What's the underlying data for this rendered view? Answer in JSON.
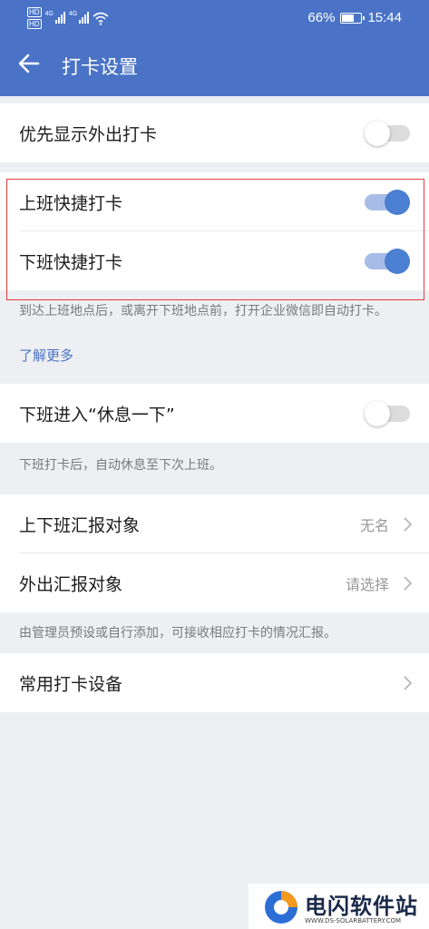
{
  "status_bar": {
    "battery_percent": "66%",
    "battery_level": 0.66,
    "time": "15:44",
    "signal_label_1": "4G",
    "signal_label_2": "4G",
    "hd_label": "HD"
  },
  "header": {
    "title": "打卡设置",
    "back_icon": "arrow-left-icon",
    "background_color": "#4a73c7"
  },
  "settings": {
    "outside_priority": {
      "label": "优先显示外出打卡",
      "enabled": false
    },
    "clock_in_quick": {
      "label": "上班快捷打卡",
      "enabled": true
    },
    "clock_out_quick": {
      "label": "下班快捷打卡",
      "enabled": true
    },
    "quick_note": "到达上班地点后，或离开下班地点前，打开企业微信即自动打卡。",
    "learn_more": "了解更多",
    "rest_after_work": {
      "label": "下班进入“休息一下”",
      "enabled": false
    },
    "rest_note": "下班打卡后，自动休息至下次上班。",
    "report_target_work": {
      "label": "上下班汇报对象",
      "value": "无名"
    },
    "report_target_outside": {
      "label": "外出汇报对象",
      "value": "请选择"
    },
    "report_note": "由管理员预设或自行添加，可接收相应打卡的情况汇报。",
    "common_devices": {
      "label": "常用打卡设备"
    }
  },
  "watermark": {
    "brand": "电闪软件站",
    "url": "WWW.DS-SOLARBATTERY.COM"
  },
  "colors": {
    "switch_on": "#4a7fd1",
    "highlight_box": "#e23b3b",
    "link": "#4a73c7"
  }
}
